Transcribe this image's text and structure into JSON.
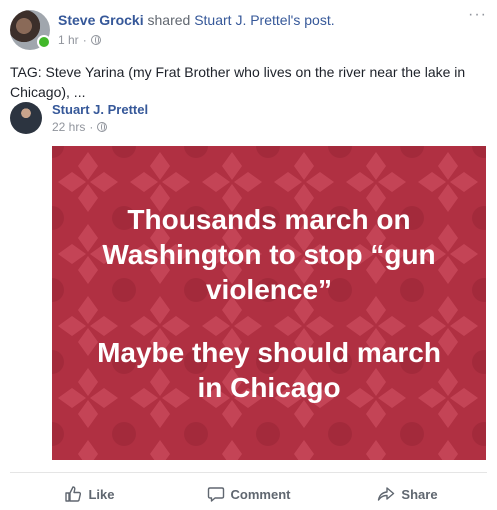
{
  "post": {
    "author": "Steve Grocki",
    "action_text": "shared",
    "shared_from": "Stuart J. Prettel's post.",
    "time": "1 hr",
    "separator": "·",
    "more": "···",
    "text_line1": "TAG: Steve Yarina (my Frat Brother who lives on the river near the lake in",
    "text_line2": "Chicago), ..."
  },
  "shared": {
    "author": "Stuart J. Prettel",
    "time": "22 hrs",
    "separator": "·"
  },
  "meme": {
    "line1": "Thousands march on",
    "line2": "Washington to stop “gun",
    "line3": "violence”",
    "line4": "Maybe they should march",
    "line5": "in Chicago",
    "background_color": "#b03042",
    "pattern_color": "#c44456"
  },
  "actions": {
    "like": "Like",
    "comment": "Comment",
    "share": "Share"
  },
  "colors": {
    "link": "#365899",
    "online": "#42b72a"
  }
}
